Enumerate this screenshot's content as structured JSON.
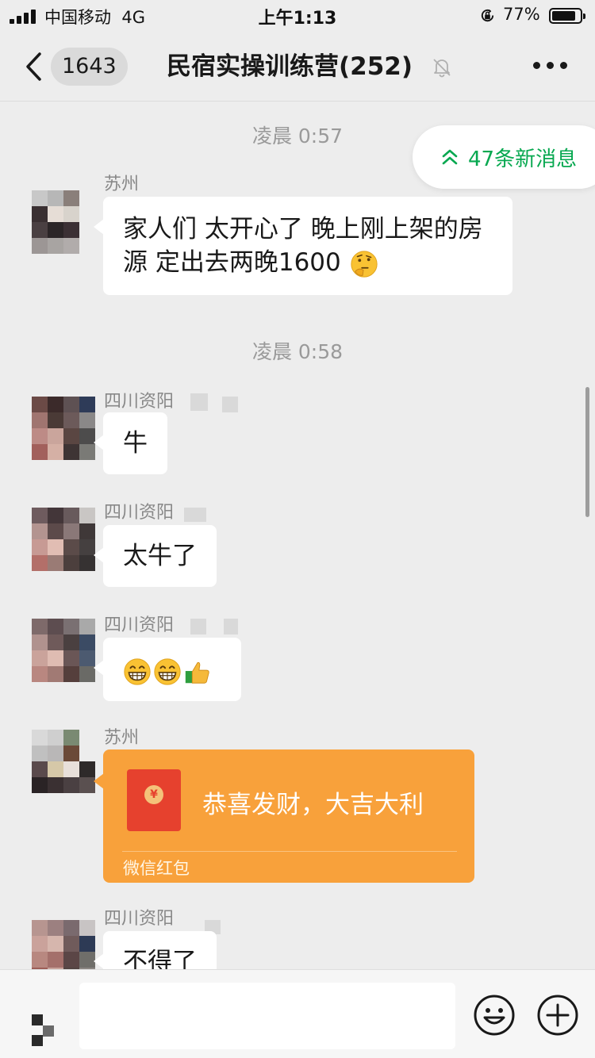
{
  "status_bar": {
    "carrier": "中国移动",
    "network": "4G",
    "time": "上午1:13",
    "battery": "77%",
    "battery_level": 0.77,
    "icons": [
      "signal-icon",
      "orientation-lock-icon",
      "battery-icon"
    ]
  },
  "nav": {
    "unread_count": "1643",
    "title": "民宿实操训练营(252)",
    "icons": [
      "back-arrow-icon",
      "mute-bell-icon",
      "more-dots-icon"
    ]
  },
  "new_messages": {
    "label": "47条新消息",
    "icon": "double-chevron-up-icon",
    "color": "#07a850"
  },
  "messages": [
    {
      "time": "凌晨 0:57"
    },
    {
      "sender": "苏州",
      "text": "家人们 太开心了 晚上刚上架的房源 定出去两晚1600",
      "emoji": "thinking-face"
    },
    {
      "time": "凌晨 0:58"
    },
    {
      "sender": "四川资阳",
      "text": "牛"
    },
    {
      "sender": "四川资阳",
      "text": "太牛了"
    },
    {
      "sender": "四川资阳",
      "emojis": [
        "grinning-face",
        "grinning-face",
        "thumbs-up"
      ]
    },
    {
      "sender": "苏州",
      "red_packet": {
        "greeting": "恭喜发财，大吉大利",
        "label": "微信红包",
        "color": "#f8a13b"
      }
    },
    {
      "sender": "四川资阳",
      "text": "不得了"
    }
  ],
  "input_bar": {
    "icons": [
      "voice-icon",
      "emoji-icon",
      "plus-icon"
    ]
  }
}
